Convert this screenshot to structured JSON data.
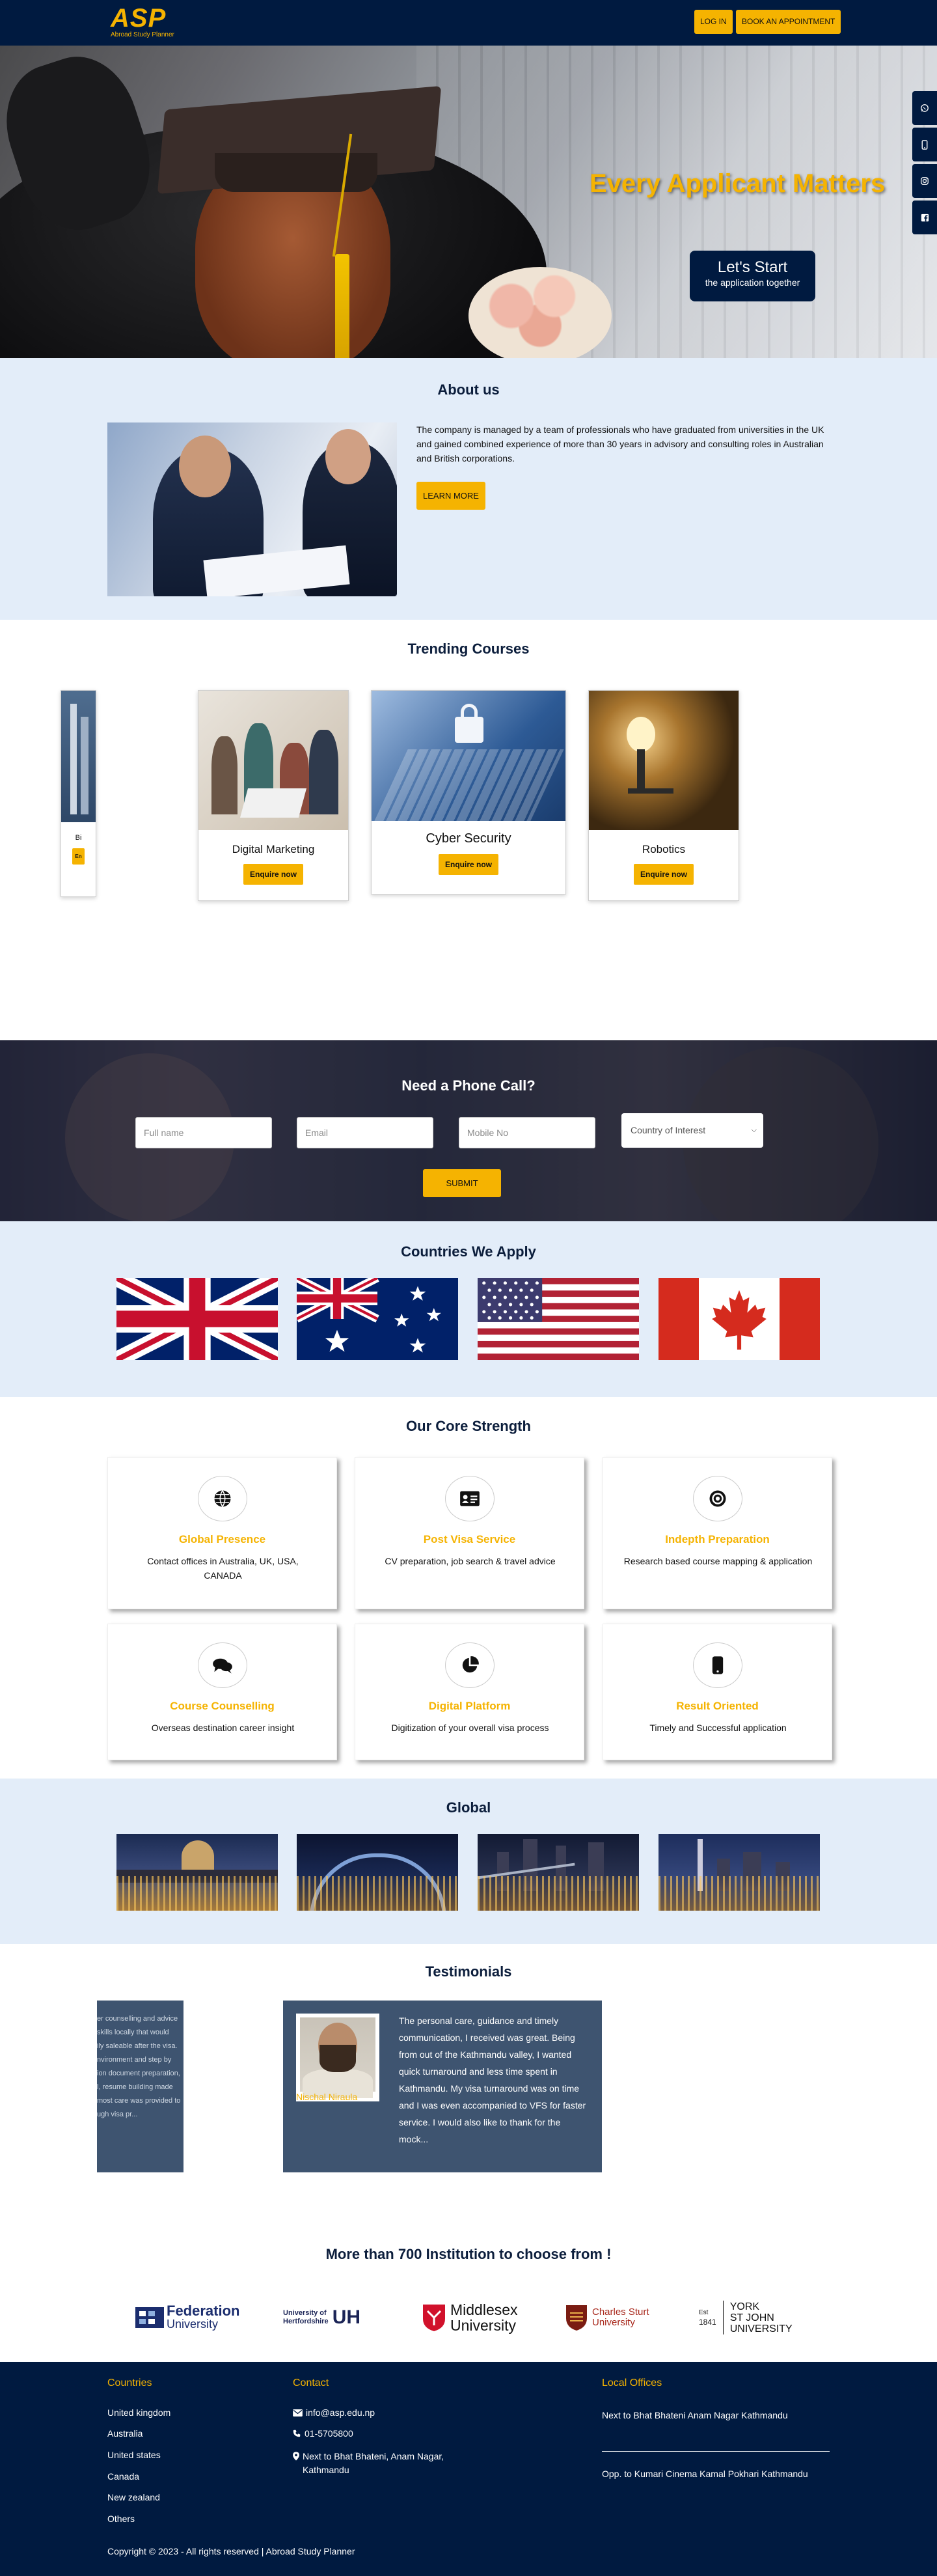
{
  "brand": {
    "logo_text": "ASP",
    "logo_sub": "Abroad Study Planner"
  },
  "nav": {
    "login_label": "LOG IN",
    "book_label": "BOOK AN APPOINTMENT"
  },
  "hero": {
    "title": "Every Applicant Matters",
    "cta_line1": "Let's Start",
    "cta_line2": "the application together"
  },
  "social_icons": [
    "whatsapp-icon",
    "phone-icon",
    "instagram-icon",
    "facebook-icon"
  ],
  "about": {
    "title": "About us",
    "text": "The company is managed by a team of professionals who have graduated from universities in the UK and gained combined experience of more than 30 years in advisory and consulting roles in Australian and British corporations.",
    "button": "LEARN MORE"
  },
  "trending": {
    "title": "Trending Courses",
    "courses": [
      {
        "name": "Digital Marketing",
        "button": "Enquire now"
      },
      {
        "name": "Cyber Security",
        "button": "Enquire now"
      },
      {
        "name": "Robotics",
        "button": "Enquire now"
      }
    ],
    "partial_name": "Bi",
    "partial_button": "En"
  },
  "phone": {
    "title": "Need a Phone Call?",
    "fullname_placeholder": "Full name",
    "email_placeholder": "Email",
    "mobile_placeholder": "Mobile No",
    "country_select": "Country of Interest",
    "submit": "SUBMIT"
  },
  "countries": {
    "title": "Countries We Apply",
    "flags": [
      "United Kingdom flag",
      "Australia flag",
      "United States flag",
      "Canada flag"
    ]
  },
  "core": {
    "title": "Our Core Strength",
    "items": [
      {
        "icon": "globe-icon",
        "title": "Global Presence",
        "desc": "Contact offices in Australia, UK, USA, CANADA"
      },
      {
        "icon": "id-card-icon",
        "title": "Post Visa Service",
        "desc": "CV preparation, job search & travel advice"
      },
      {
        "icon": "target-icon",
        "title": "Indepth Preparation",
        "desc": "Research based course mapping & application"
      },
      {
        "icon": "comments-icon",
        "title": "Course Counselling",
        "desc": "Overseas destination career insight"
      },
      {
        "icon": "pie-chart-icon",
        "title": "Digital Platform",
        "desc": "Digitization of your overall visa process"
      },
      {
        "icon": "mobile-icon",
        "title": "Result Oriented",
        "desc": "Timely and Successful application"
      }
    ]
  },
  "global": {
    "title": "Global"
  },
  "testimonials": {
    "title": "Testimonials",
    "partial_lines": [
      "er counselling and advice",
      "skills locally that would",
      "ily saleable after the visa.",
      "nvironment and step by",
      "ion document preparation,",
      "l, resume building made",
      "most care was provided to",
      "ugh visa pr..."
    ],
    "name": "Nischal Niraula",
    "text": "The personal care, guidance and timely communication, I received was great. Being from out of the Kathmandu valley, I wanted quick turnaround and less time spent in Kathmandu. My visa turnaround was on time and I was even accompanied to VFS for faster service. I would also like to thank for the mock..."
  },
  "institutions": {
    "title": "More than 700 Institution to choose from !",
    "logos": [
      {
        "name1": "Federation",
        "name2": "University"
      },
      {
        "name1": "University of",
        "name2": "Hertfordshire",
        "mark": "UH"
      },
      {
        "name1": "Middlesex",
        "name2": "University"
      },
      {
        "name1": "Charles Sturt",
        "name2": "University"
      },
      {
        "est": "Est",
        "year": "1841",
        "name1": "YORK",
        "name2": "ST JOHN",
        "name3": "UNIVERSITY"
      }
    ]
  },
  "footer": {
    "countries_title": "Countries",
    "countries": [
      "United kingdom",
      "Australia",
      "United states",
      "Canada",
      "New zealand",
      "Others"
    ],
    "contact_title": "Contact",
    "email": "info@asp.edu.np",
    "phone": "01-5705800",
    "address": "Next to Bhat Bhateni, Anam Nagar, Kathmandu",
    "offices_title": "Local Offices",
    "office1": "Next to Bhat Bhateni Anam Nagar Kathmandu",
    "office2": "Opp. to Kumari Cinema Kamal Pokhari Kathmandu",
    "copyright": "Copyright © 2023 - All rights reserved | Abroad Study Planner"
  },
  "colors": {
    "navy": "#001a40",
    "accent": "#f5b301",
    "light_bg": "#e3edf9",
    "card_blue": "#3e5470"
  }
}
